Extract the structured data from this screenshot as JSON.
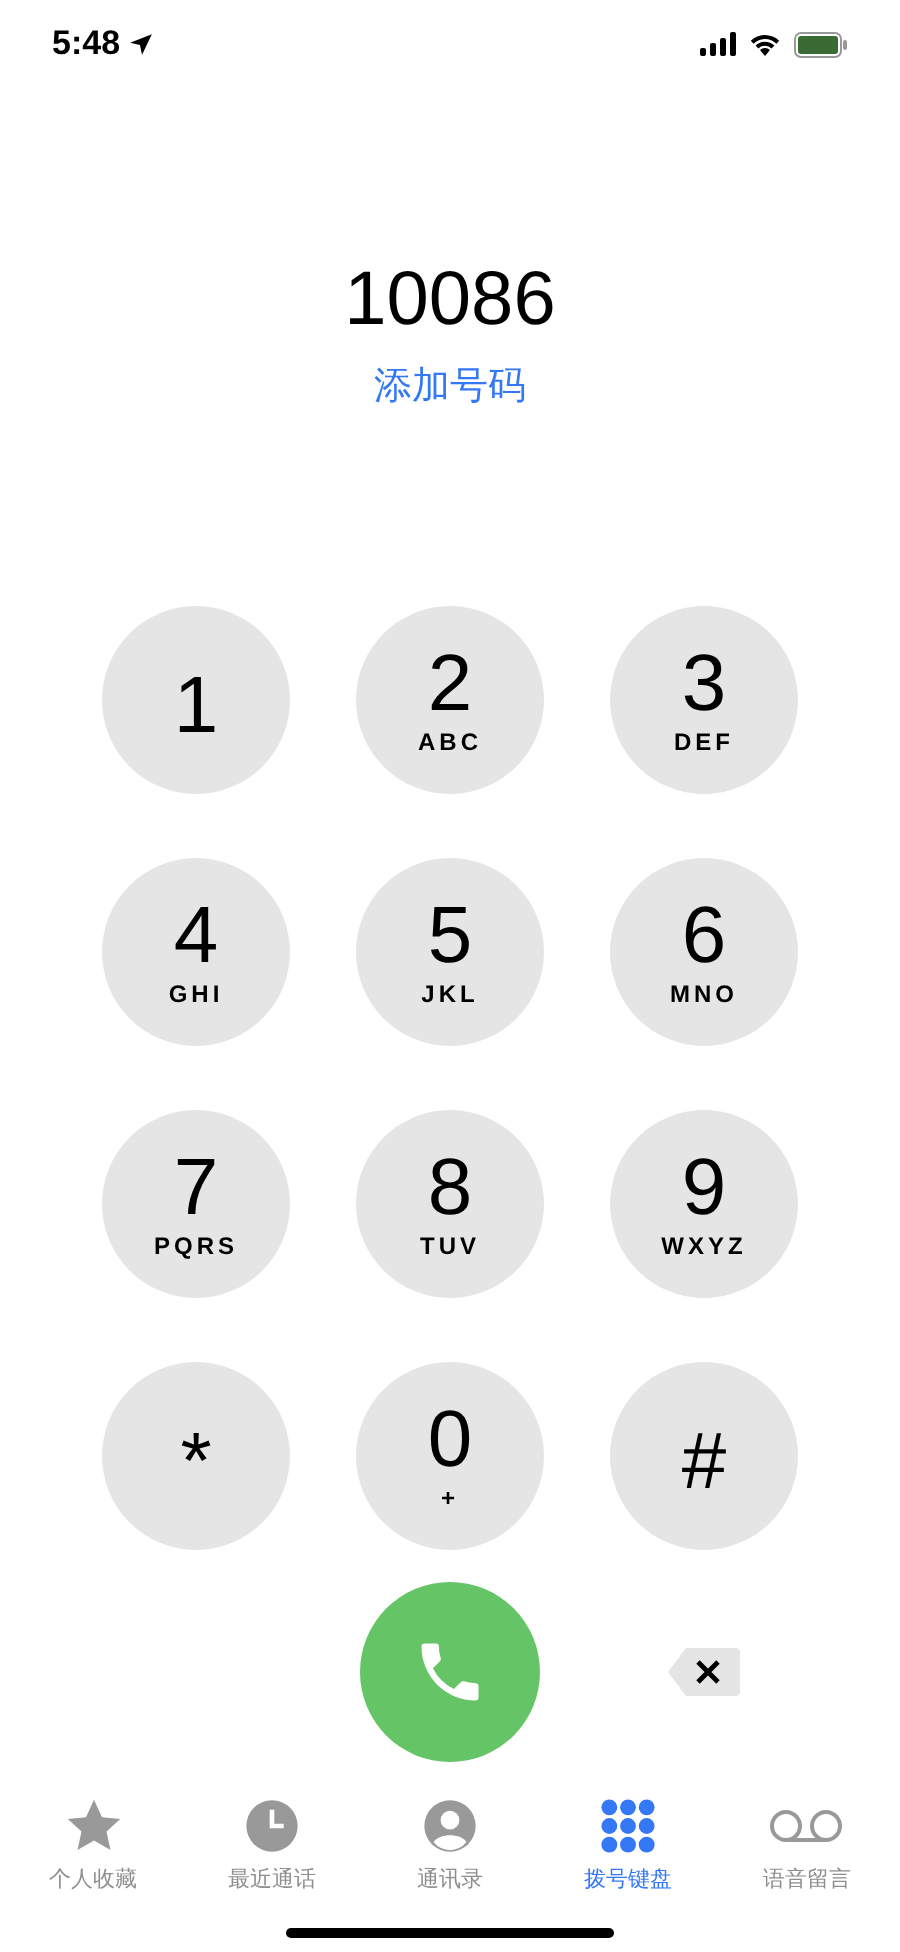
{
  "status_bar": {
    "time": "5:48"
  },
  "dialed_number": "10086",
  "add_number_link": "添加号码",
  "keys": [
    {
      "digit": "1"
    },
    {
      "digit": "2",
      "letters": "ABC"
    },
    {
      "digit": "3",
      "letters": "DEF"
    },
    {
      "digit": "4",
      "letters": "GHI"
    },
    {
      "digit": "5",
      "letters": "JKL"
    },
    {
      "digit": "6",
      "letters": "MNO"
    },
    {
      "digit": "7",
      "letters": "PQRS"
    },
    {
      "digit": "8",
      "letters": "TUV"
    },
    {
      "digit": "9",
      "letters": "WXYZ"
    },
    {
      "digit": "*"
    },
    {
      "digit": "0",
      "letters": "+"
    },
    {
      "digit": "#"
    }
  ],
  "tabs": [
    {
      "label": "个人收藏",
      "kind": "star",
      "selected": false
    },
    {
      "label": "最近通话",
      "kind": "clock",
      "selected": false
    },
    {
      "label": "通讯录",
      "kind": "person",
      "selected": false
    },
    {
      "label": "拨号键盘",
      "kind": "keypad",
      "selected": true
    },
    {
      "label": "语音留言",
      "kind": "voicemail",
      "selected": false
    }
  ]
}
